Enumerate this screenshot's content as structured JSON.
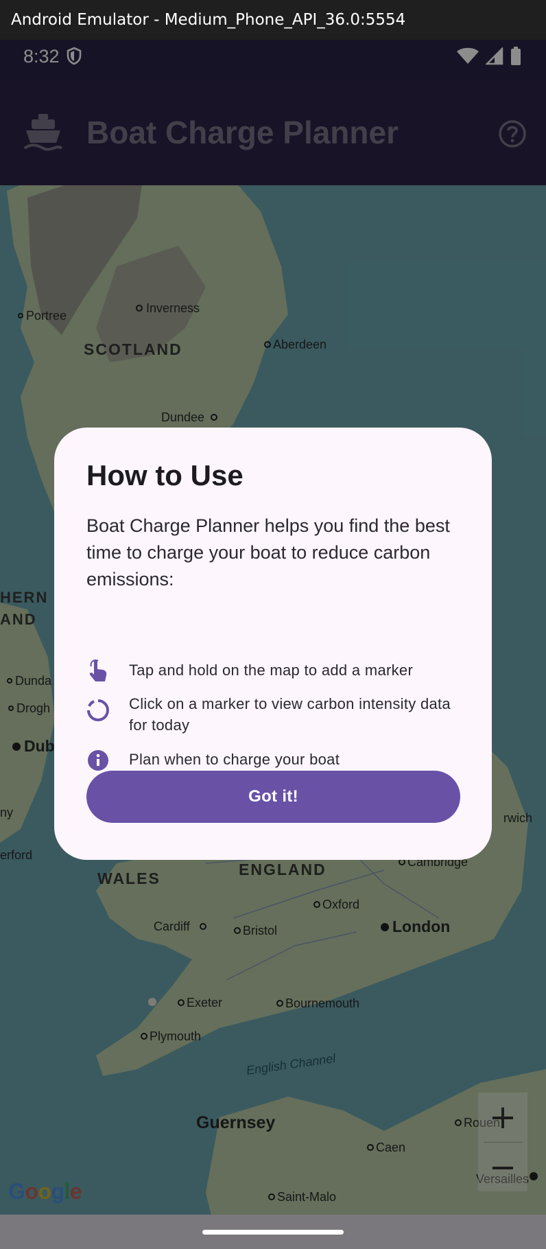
{
  "window": {
    "title": "Android Emulator - Medium_Phone_API_36.0:5554"
  },
  "status_bar": {
    "time": "8:32"
  },
  "app_bar": {
    "title": "Boat Charge Planner"
  },
  "map": {
    "place_labels": [
      "Portree",
      "Inverness",
      "SCOTLAND",
      "Aberdeen",
      "Dundee",
      "HERN",
      "AND",
      "Dunda",
      "Drogh",
      "Dub",
      "ny",
      "erford",
      "WALES",
      "ENGLAND",
      "rwich",
      "Cambridge",
      "Oxford",
      "Cardiff",
      "Bristol",
      "London",
      "Exeter",
      "Bournemouth",
      "Plymouth",
      "English Channel",
      "Guernsey",
      "Caen",
      "Rouen",
      "Saint-Malo",
      "Versailles"
    ],
    "attribution": "Google",
    "zoom_in": "+",
    "zoom_out": "−"
  },
  "dialog": {
    "title": "How to Use",
    "intro": "Boat Charge Planner helps you find the best time to charge your boat to reduce carbon emissions:",
    "steps": [
      {
        "icon": "touch-icon",
        "text": "Tap and hold on the map to add a marker"
      },
      {
        "icon": "loading-icon",
        "text": "Click on a marker to view carbon intensity data for today"
      },
      {
        "icon": "info-icon",
        "text": "Plan when to charge your boat"
      }
    ],
    "button_label": "Got it!"
  },
  "colors": {
    "app_bar": "#2e2348",
    "dialog_bg": "#fdf6fd",
    "primary": "#6951a6",
    "sea": "#3e6b72"
  }
}
